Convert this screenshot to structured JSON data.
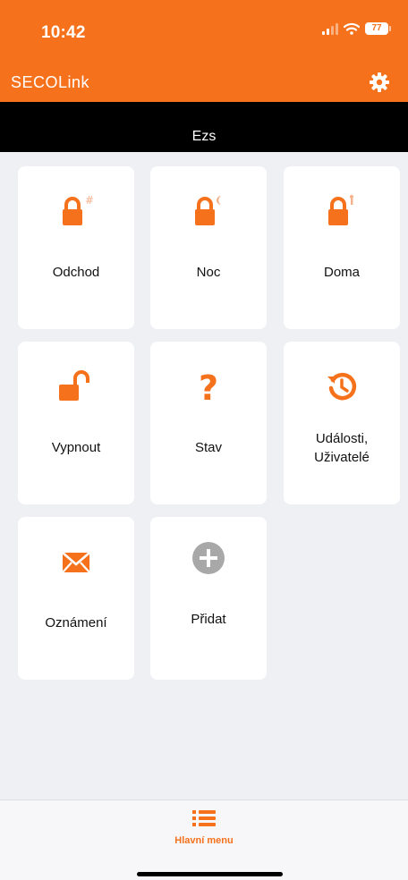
{
  "status_bar": {
    "time": "10:42",
    "battery": "77"
  },
  "app_bar": {
    "logo": "SECOLink",
    "settings_icon": "gear-icon"
  },
  "section": {
    "name": "Ezs"
  },
  "tiles": [
    {
      "label": "Odchod",
      "icon": "lock-away-icon"
    },
    {
      "label": "Noc",
      "icon": "lock-night-icon"
    },
    {
      "label": "Doma",
      "icon": "lock-home-icon"
    },
    {
      "label": "Vypnout",
      "icon": "unlock-icon"
    },
    {
      "label": "Stav",
      "icon": "question-icon"
    },
    {
      "label_line1": "Události,",
      "label_line2": "Uživatelé",
      "icon": "history-icon"
    },
    {
      "label": "Oznámení",
      "icon": "envelope-icon"
    },
    {
      "label": "Přidat",
      "icon": "add-icon"
    }
  ],
  "bottom_nav": {
    "label": "Hlavní menu",
    "icon": "list-icon"
  },
  "colors": {
    "accent": "#f6711c",
    "add_icon": "#a8a8a8"
  }
}
